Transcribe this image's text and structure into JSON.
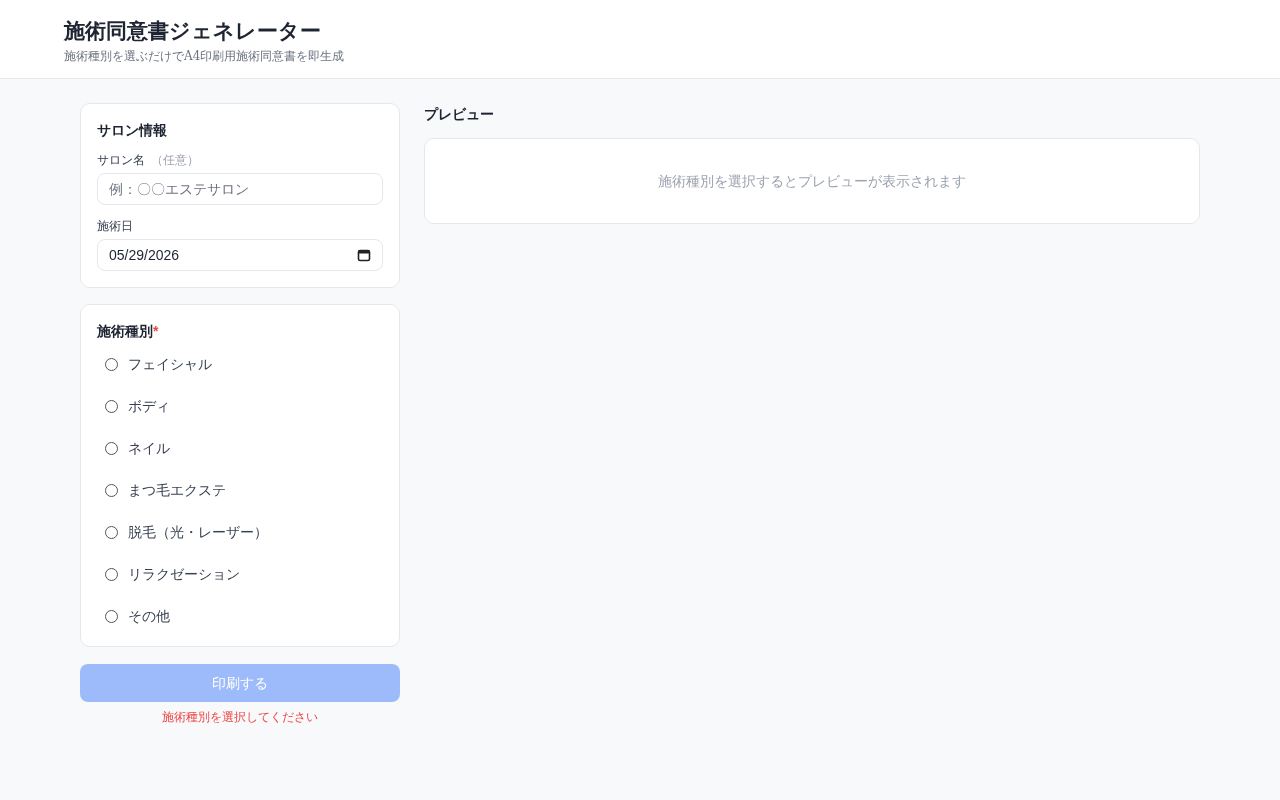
{
  "header": {
    "title": "施術同意書ジェネレーター",
    "subtitle": "施術種別を選ぶだけでA4印刷用施術同意書を即生成"
  },
  "salon": {
    "title": "サロン情報",
    "name_label": "サロン名",
    "name_optional": "（任意）",
    "name_placeholder": "例：〇〇エステサロン",
    "date_label": "施術日",
    "date_value": "05/29/2026"
  },
  "treatment": {
    "title": "施術種別",
    "required_mark": "*",
    "options": [
      {
        "label": "フェイシャル",
        "selected": false
      },
      {
        "label": "ボディ",
        "selected": false
      },
      {
        "label": "ネイル",
        "selected": false
      },
      {
        "label": "まつ毛エクステ",
        "selected": false
      },
      {
        "label": "脱毛（光・レーザー）",
        "selected": false
      },
      {
        "label": "リラクゼーション",
        "selected": false
      },
      {
        "label": "その他",
        "selected": false
      }
    ]
  },
  "print_button": {
    "label": "印刷する",
    "disabled": true
  },
  "error": "施術種別を選択してください",
  "preview": {
    "title": "プレビュー",
    "empty_message": "施術種別を選択するとプレビューが表示されます"
  }
}
